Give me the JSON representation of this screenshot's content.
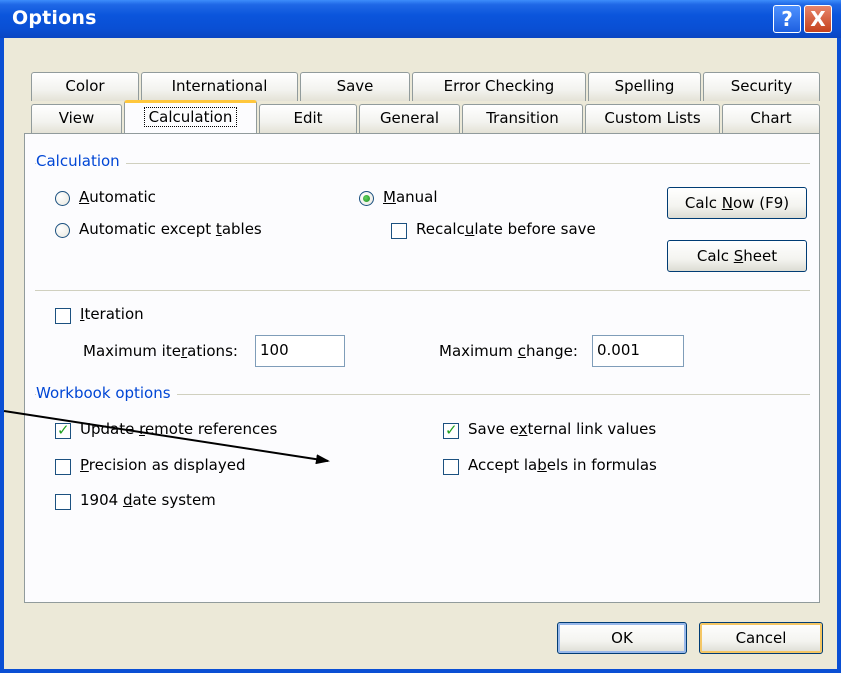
{
  "window": {
    "title": "Options"
  },
  "titlebar_buttons": {
    "help": "?",
    "close": "X"
  },
  "tabs_row1": [
    "Color",
    "International",
    "Save",
    "Error Checking",
    "Spelling",
    "Security"
  ],
  "tabs_row2": [
    "View",
    "Calculation",
    "Edit",
    "General",
    "Transition",
    "Custom Lists",
    "Chart"
  ],
  "active_tab": "Calculation",
  "calculation": {
    "group_label": "Calculation",
    "automatic": {
      "pre": "",
      "u": "A",
      "post": "utomatic"
    },
    "automatic_except_tables": {
      "pre": "Automatic except ",
      "u": "t",
      "post": "ables"
    },
    "manual": {
      "pre": "",
      "u": "M",
      "post": "anual"
    },
    "recalculate_before_save": {
      "pre": "Recalc",
      "u": "u",
      "post": "late before save"
    },
    "selected": "Manual",
    "recalculate_checked": false,
    "calc_now": {
      "pre": "Calc ",
      "u": "N",
      "post": "ow (F9)"
    },
    "calc_sheet": {
      "pre": "Calc ",
      "u": "S",
      "post": "heet"
    }
  },
  "iteration": {
    "checkbox": {
      "pre": "",
      "u": "I",
      "post": "teration"
    },
    "checked": false,
    "max_iterations_label": {
      "pre": "Maximum ite",
      "u": "r",
      "post": "ations:"
    },
    "max_iterations_value": "100",
    "max_change_label": {
      "pre": "Maximum ",
      "u": "c",
      "post": "hange:"
    },
    "max_change_value": "0.001"
  },
  "workbook": {
    "group_label": "Workbook options",
    "update_remote": {
      "pre": "Update ",
      "u": "r",
      "post": "emote references",
      "checked": true
    },
    "precision": {
      "pre": "",
      "u": "P",
      "post": "recision as displayed",
      "checked": false
    },
    "date_1904": {
      "pre": "1904 ",
      "u": "d",
      "post": "ate system",
      "checked": false
    },
    "save_external": {
      "pre": "Save e",
      "u": "x",
      "post": "ternal link values",
      "checked": true
    },
    "accept_labels": {
      "pre": "Accept la",
      "u": "b",
      "post": "els in formulas",
      "checked": false
    }
  },
  "footer": {
    "ok": "OK",
    "cancel": "Cancel"
  },
  "colors": {
    "titlebar": "#0a4fd4",
    "dialog": "#ece9d8",
    "group_label": "#0046d5",
    "active_tab_accent": "#ffc73c"
  }
}
